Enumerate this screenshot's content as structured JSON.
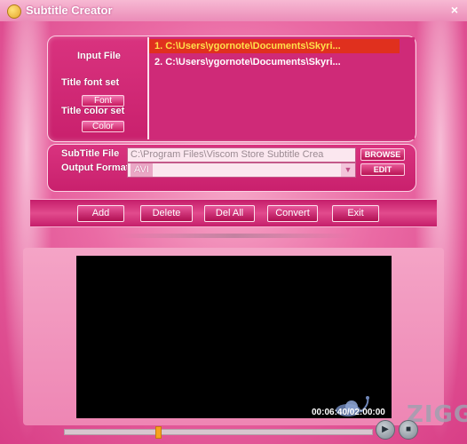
{
  "window": {
    "title": "Subtitle Creator",
    "close_glyph": "×"
  },
  "input": {
    "input_file_label": "Input File",
    "title_font_label": "Title font set",
    "font_button": "Font",
    "title_color_label": "Title color set",
    "color_button": "Color",
    "files": [
      "1.  C:\\Users\\ygornote\\Documents\\Skyri...",
      "2.  C:\\Users\\ygornote\\Documents\\Skyri..."
    ]
  },
  "output": {
    "subtitle_label": "SubTitle File",
    "subtitle_path": "C:\\Program Files\\Viscom Store Subtitle Crea",
    "browse_button": "BROWSE",
    "format_label": "Output Format",
    "format_value": "AVI",
    "edit_button": "EDIT"
  },
  "toolbar": {
    "add": "Add",
    "delete": "Delete",
    "del_all": "Del All",
    "convert": "Convert",
    "exit": "Exit"
  },
  "player": {
    "time": "00:06:40/02:00:00",
    "progress": 0.3,
    "play_icon": "play-icon",
    "stop_icon": "stop-icon",
    "play_glyph": "▶",
    "stop_glyph": "■"
  },
  "watermark": "ZIGG",
  "colors": {
    "accent": "#d9337f",
    "selected_row": "#e0301e",
    "selected_text": "#ffe14a"
  }
}
